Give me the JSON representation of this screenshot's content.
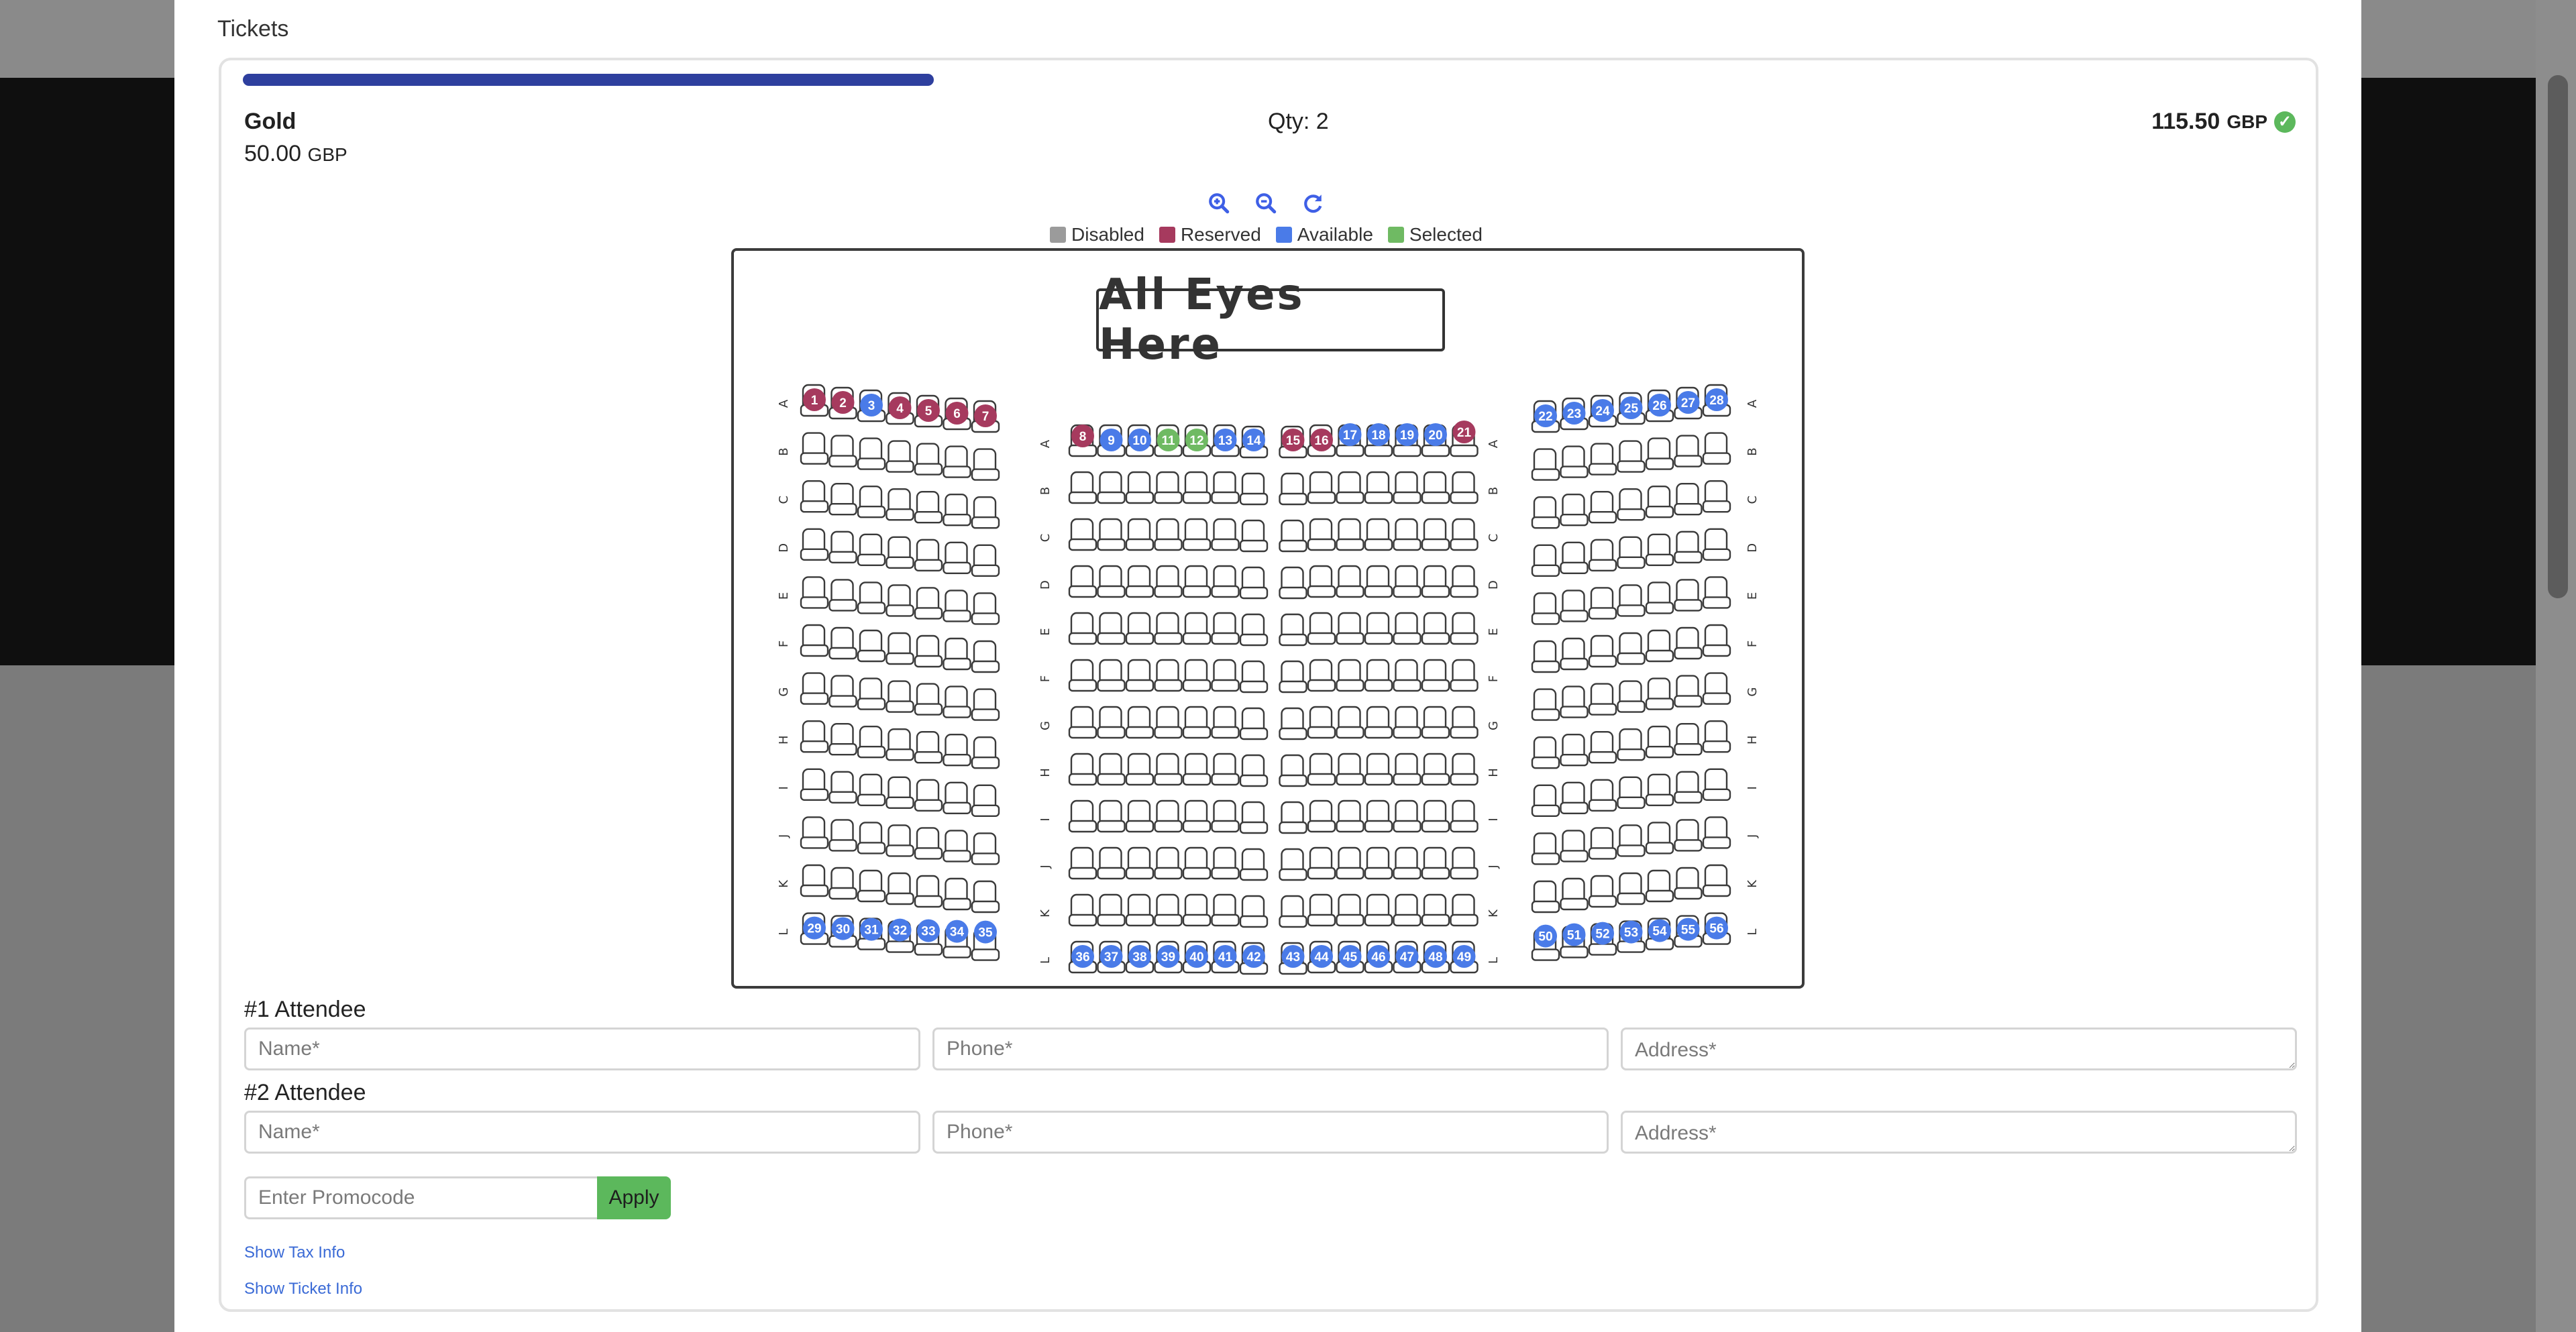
{
  "page": {
    "heading": "Tickets"
  },
  "ticket": {
    "progress_fraction": 0.33,
    "tier_name": "Gold",
    "tier_price": "50.00",
    "currency": "GBP",
    "qty": "Qty: 2",
    "total": "115.50",
    "total_currency": "GBP"
  },
  "zoom": {
    "zoom_in_icon": "zoom-in-icon",
    "zoom_out_icon": "zoom-out-icon",
    "reset_icon": "refresh-icon"
  },
  "legend": [
    {
      "label": "Disabled",
      "color": "#9b9b9b"
    },
    {
      "label": "Reserved",
      "color": "#a63a5e"
    },
    {
      "label": "Available",
      "color": "#4a7be8"
    },
    {
      "label": "Selected",
      "color": "#6fba63"
    }
  ],
  "seatmap": {
    "stage_label": "All Eyes Here",
    "row_labels": [
      "A",
      "B",
      "C",
      "D",
      "E",
      "F",
      "G",
      "H",
      "I",
      "J",
      "K",
      "L"
    ],
    "colors": {
      "reserved": "#a63a5e",
      "available": "#4a7be8",
      "selected": "#6fba63"
    },
    "row_a_left": [
      {
        "n": "1",
        "s": "reserved"
      },
      {
        "n": "2",
        "s": "reserved"
      },
      {
        "n": "3",
        "s": "available"
      },
      {
        "n": "4",
        "s": "reserved"
      },
      {
        "n": "5",
        "s": "reserved"
      },
      {
        "n": "6",
        "s": "reserved"
      },
      {
        "n": "7",
        "s": "reserved"
      }
    ],
    "row_a_center": [
      {
        "n": "8",
        "s": "reserved"
      },
      {
        "n": "9",
        "s": "available"
      },
      {
        "n": "10",
        "s": "available"
      },
      {
        "n": "11",
        "s": "selected"
      },
      {
        "n": "12",
        "s": "selected"
      },
      {
        "n": "13",
        "s": "available"
      },
      {
        "n": "14",
        "s": "available"
      },
      {
        "n": "15",
        "s": "reserved"
      },
      {
        "n": "16",
        "s": "reserved"
      },
      {
        "n": "17",
        "s": "available"
      },
      {
        "n": "18",
        "s": "available"
      },
      {
        "n": "19",
        "s": "available"
      },
      {
        "n": "20",
        "s": "available"
      },
      {
        "n": "21",
        "s": "reserved"
      }
    ],
    "row_a_right": [
      {
        "n": "22",
        "s": "available"
      },
      {
        "n": "23",
        "s": "available"
      },
      {
        "n": "24",
        "s": "available"
      },
      {
        "n": "25",
        "s": "available"
      },
      {
        "n": "26",
        "s": "available"
      },
      {
        "n": "27",
        "s": "available"
      },
      {
        "n": "28",
        "s": "available"
      }
    ],
    "row_l_left": [
      {
        "n": "29",
        "s": "available"
      },
      {
        "n": "30",
        "s": "available"
      },
      {
        "n": "31",
        "s": "available"
      },
      {
        "n": "32",
        "s": "available"
      },
      {
        "n": "33",
        "s": "available"
      },
      {
        "n": "34",
        "s": "available"
      },
      {
        "n": "35",
        "s": "available"
      }
    ],
    "row_l_center": [
      {
        "n": "36",
        "s": "available"
      },
      {
        "n": "37",
        "s": "available"
      },
      {
        "n": "38",
        "s": "available"
      },
      {
        "n": "39",
        "s": "available"
      },
      {
        "n": "40",
        "s": "available"
      },
      {
        "n": "41",
        "s": "available"
      },
      {
        "n": "42",
        "s": "available"
      },
      {
        "n": "43",
        "s": "available"
      },
      {
        "n": "44",
        "s": "available"
      },
      {
        "n": "45",
        "s": "available"
      },
      {
        "n": "46",
        "s": "available"
      },
      {
        "n": "47",
        "s": "available"
      },
      {
        "n": "48",
        "s": "available"
      },
      {
        "n": "49",
        "s": "available"
      }
    ],
    "row_l_right": [
      {
        "n": "50",
        "s": "available"
      },
      {
        "n": "51",
        "s": "available"
      },
      {
        "n": "52",
        "s": "available"
      },
      {
        "n": "53",
        "s": "available"
      },
      {
        "n": "54",
        "s": "available"
      },
      {
        "n": "55",
        "s": "available"
      },
      {
        "n": "56",
        "s": "available"
      }
    ]
  },
  "attendees": [
    {
      "label": "#1 Attendee",
      "name_placeholder": "Name*",
      "phone_placeholder": "Phone*",
      "address_placeholder": "Address*"
    },
    {
      "label": "#2 Attendee",
      "name_placeholder": "Name*",
      "phone_placeholder": "Phone*",
      "address_placeholder": "Address*"
    }
  ],
  "promo": {
    "placeholder": "Enter Promocode",
    "apply_label": "Apply"
  },
  "links": {
    "tax": "Show Tax Info",
    "ticket": "Show Ticket Info"
  }
}
